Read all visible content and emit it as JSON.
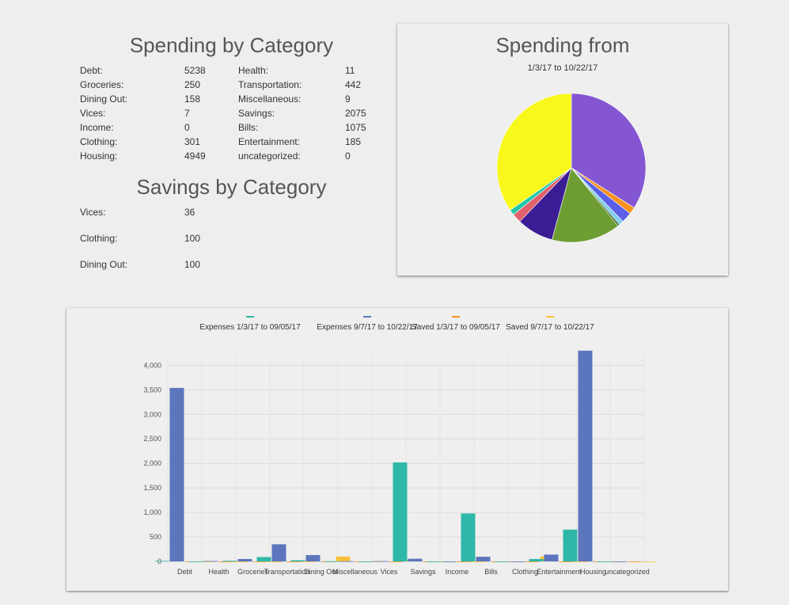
{
  "spending_section": {
    "title": "Spending by Category",
    "items": [
      {
        "label": "Debt:",
        "value": "5238"
      },
      {
        "label": "Groceries:",
        "value": "250"
      },
      {
        "label": "Dining Out:",
        "value": "158"
      },
      {
        "label": "Vices:",
        "value": "7"
      },
      {
        "label": "Income:",
        "value": "0"
      },
      {
        "label": "Clothing:",
        "value": "301"
      },
      {
        "label": "Housing:",
        "value": "4949"
      },
      {
        "label": "Health:",
        "value": "11"
      },
      {
        "label": "Transportation:",
        "value": "442"
      },
      {
        "label": "Miscellaneous:",
        "value": "9"
      },
      {
        "label": "Savings:",
        "value": "2075"
      },
      {
        "label": "Bills:",
        "value": "1075"
      },
      {
        "label": "Entertainment:",
        "value": "185"
      },
      {
        "label": "uncategorized:",
        "value": "0"
      }
    ]
  },
  "savings_section": {
    "title": "Savings by Category",
    "items": [
      {
        "label": "Vices:",
        "value": "36"
      },
      {
        "label": "Clothing:",
        "value": "100"
      },
      {
        "label": "Dining Out:",
        "value": "100"
      }
    ]
  },
  "pie_card": {
    "title": "Spending from",
    "subtitle": "1/3/17 to 10/22/17"
  },
  "chart_data": [
    {
      "type": "pie",
      "title": "Spending from",
      "subtitle": "1/3/17 to 10/22/17",
      "slices": [
        {
          "value": 34,
          "color": "#8456d2"
        },
        {
          "value": 1.5,
          "color": "#f7931e"
        },
        {
          "value": 2.3,
          "color": "#5b5ee6"
        },
        {
          "value": 1,
          "color": "#80d0ee"
        },
        {
          "value": 0.4,
          "color": "#2b5a20"
        },
        {
          "value": 15,
          "color": "#6e9e33"
        },
        {
          "value": 8,
          "color": "#3a1c94"
        },
        {
          "value": 2,
          "color": "#e0616b"
        },
        {
          "value": 1.2,
          "color": "#1fc7a8"
        },
        {
          "value": 34.6,
          "color": "#f8f81c"
        }
      ]
    },
    {
      "type": "bar",
      "categories": [
        "Debt",
        "Health",
        "Groceries",
        "Transportation",
        "Dining Out",
        "Miscellaneous",
        "Vices",
        "Savings",
        "Income",
        "Bills",
        "Clothing",
        "Entertainment",
        "Housing",
        "uncategorized"
      ],
      "series": [
        {
          "name": "Expenses 1/3/17 to 09/05/17",
          "color": "#2fb8a8",
          "values": [
            10,
            0,
            15,
            90,
            25,
            5,
            0,
            2020,
            0,
            980,
            0,
            50,
            650,
            0
          ]
        },
        {
          "name": "Expenses 9/7/17 to 10/22/17",
          "color": "#5b76bd",
          "values": [
            3540,
            10,
            50,
            350,
            130,
            5,
            7,
            55,
            0,
            95,
            0,
            140,
            4300,
            0
          ]
        },
        {
          "name": "Saved 1/3/17 to 09/05/17",
          "color": "#f7931e",
          "values": [
            0,
            0,
            0,
            0,
            0,
            0,
            0,
            0,
            0,
            0,
            0,
            0,
            0,
            0
          ]
        },
        {
          "name": "Saved 9/7/17 to 10/22/17",
          "color": "#f9c13b",
          "values": [
            0,
            0,
            0,
            0,
            100,
            0,
            36,
            0,
            0,
            0,
            100,
            0,
            0,
            0
          ]
        }
      ],
      "yticks": [
        "0",
        "500",
        "1,000",
        "1,500",
        "2,000",
        "2,500",
        "3,000",
        "3,500",
        "4,000"
      ],
      "ylim": [
        0,
        4200
      ],
      "grid": true,
      "legend_position": "top"
    }
  ]
}
